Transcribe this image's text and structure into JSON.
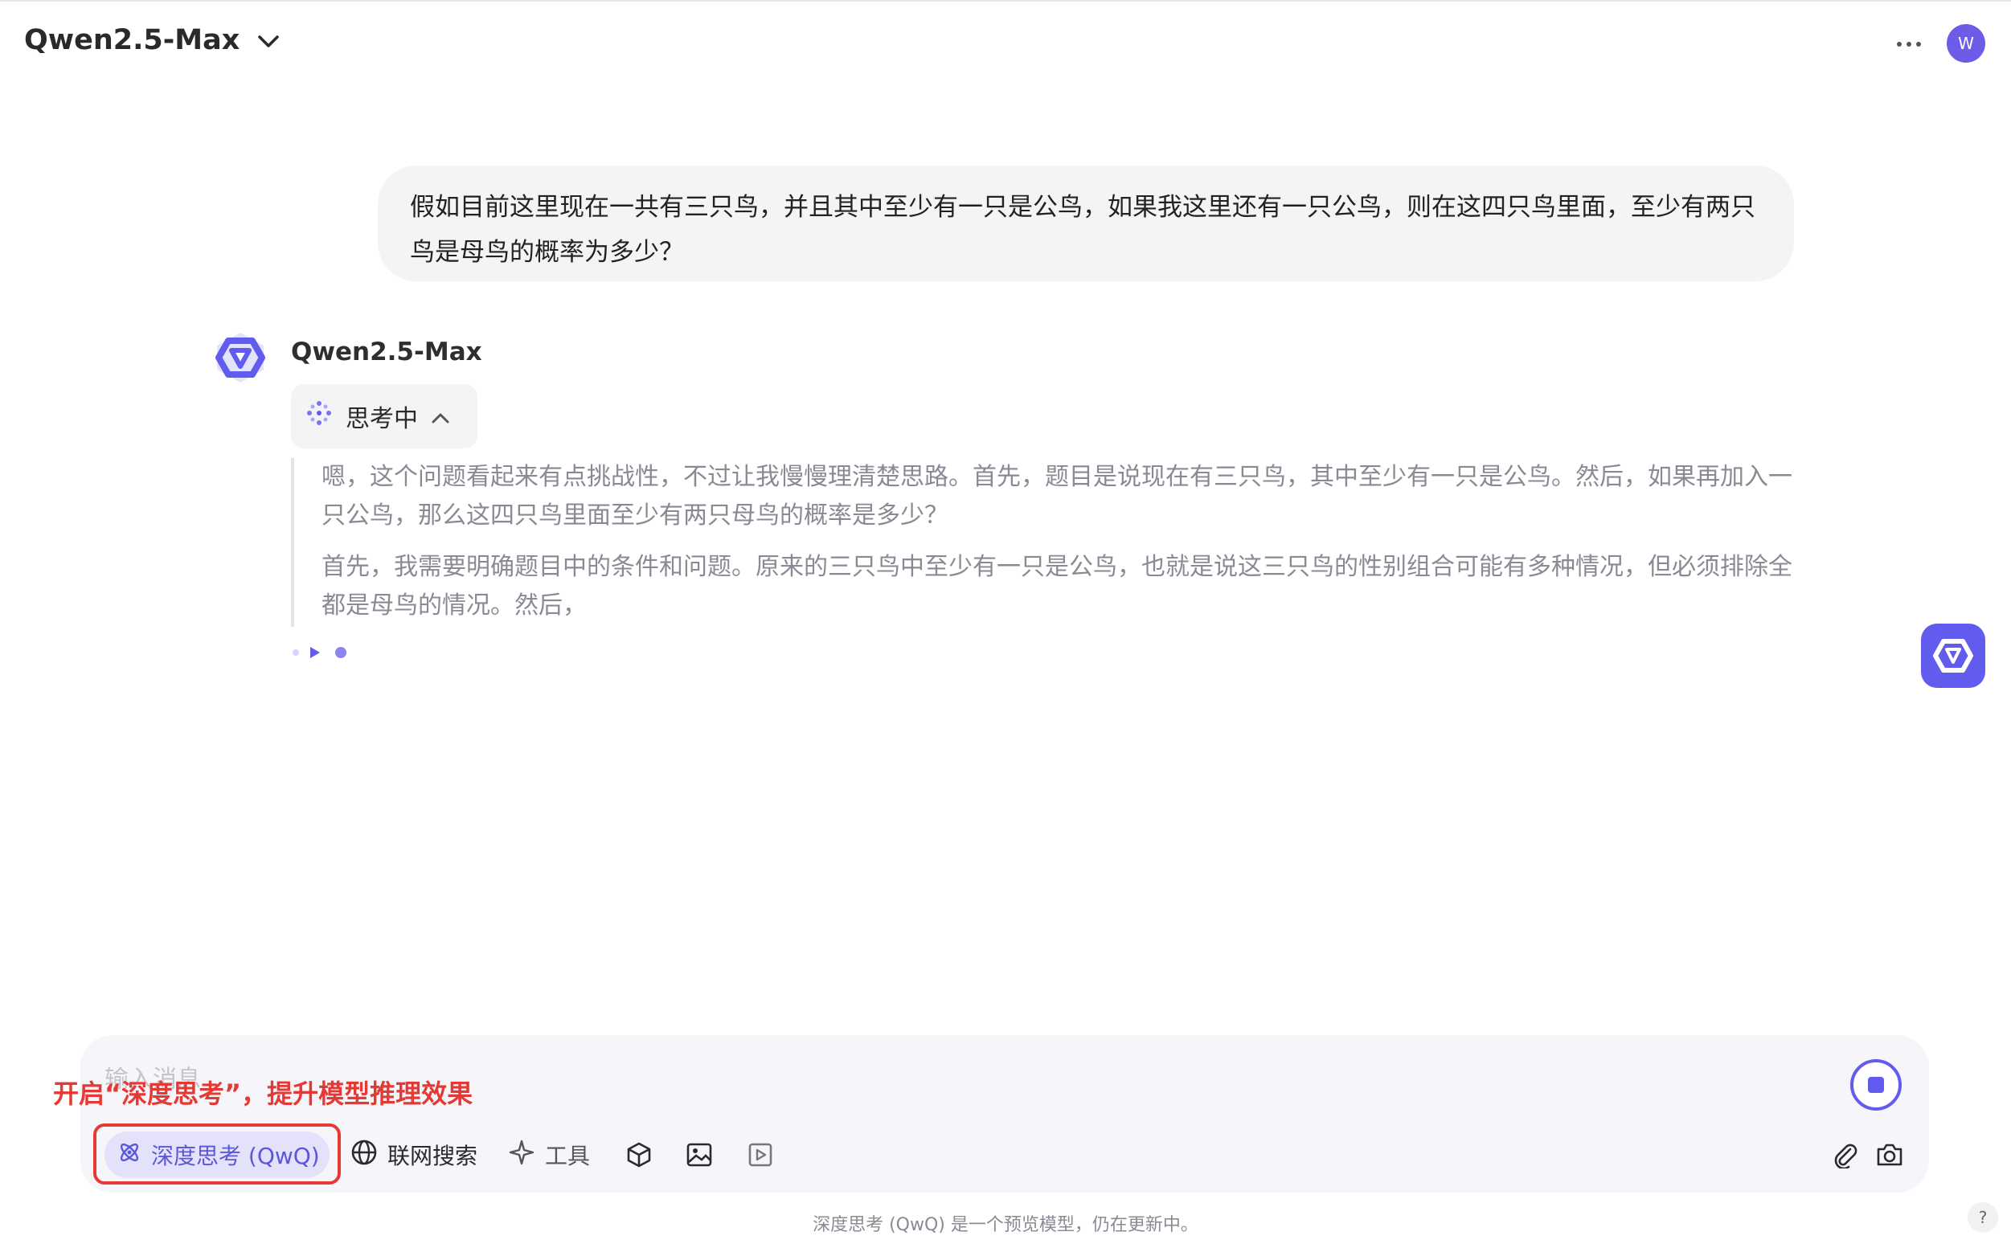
{
  "header": {
    "model_name": "Qwen2.5-Max",
    "avatar_letter": "W"
  },
  "conversation": {
    "user_message": "假如目前这里现在一共有三只鸟，并且其中至少有一只是公鸟，如果我这里还有一只公鸟，则在这四只鸟里面，至少有两只鸟是母鸟的概率为多少？",
    "assistant_name": "Qwen2.5-Max",
    "thinking_label": "思考中",
    "thinking_paragraphs": [
      "嗯，这个问题看起来有点挑战性，不过让我慢慢理清楚思路。首先，题目是说现在有三只鸟，其中至少有一只是公鸟。然后，如果再加入一只公鸟，那么这四只鸟里面至少有两只母鸟的概率是多少？",
      "首先，我需要明确题目中的条件和问题。原来的三只鸟中至少有一只是公鸟，也就是说这三只鸟的性别组合可能有多种情况，但必须排除全都是母鸟的情况。然后，"
    ]
  },
  "composer": {
    "placeholder": "输入消息",
    "annotation": "开启“深度思考”，提升模型推理效果",
    "deep_think_label": "深度思考 (QwQ)",
    "web_search_label": "联网搜索",
    "tools_label": "工具",
    "footer_note": "深度思考 (QwQ) 是一个预览模型，仍在更新中。",
    "help_label": "?"
  },
  "colors": {
    "accent": "#615ced",
    "annotation_red": "#e53935"
  },
  "icons": [
    "chevron-down-icon",
    "more-icon",
    "qwen-logo-icon",
    "thinking-sparkle-icon",
    "chevron-up-icon",
    "atom-icon",
    "globe-icon",
    "sparkle-icon",
    "cube-icon",
    "image-icon",
    "video-icon",
    "paperclip-icon",
    "camera-icon",
    "stop-icon"
  ]
}
